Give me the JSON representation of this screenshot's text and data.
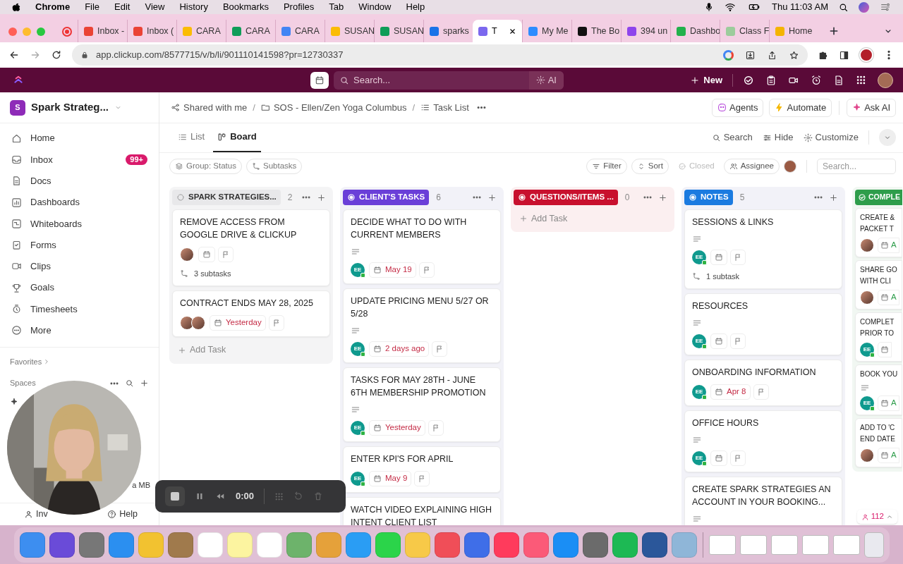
{
  "menu_bar": {
    "app": "Chrome",
    "items": [
      "File",
      "Edit",
      "View",
      "History",
      "Bookmarks",
      "Profiles",
      "Tab",
      "Window",
      "Help"
    ],
    "clock": "Thu 11:03 AM"
  },
  "browser": {
    "tabs": [
      {
        "title": "Inbox -",
        "color": "#ea4335",
        "selected": false
      },
      {
        "title": "Inbox (",
        "color": "#ea4335",
        "selected": false
      },
      {
        "title": "CARA",
        "color": "#fbbc04",
        "selected": false
      },
      {
        "title": "CARA",
        "color": "#0f9d58",
        "selected": false
      },
      {
        "title": "CARA",
        "color": "#4285f4",
        "selected": false
      },
      {
        "title": "SUSAN",
        "color": "#fbbc04",
        "selected": false
      },
      {
        "title": "SUSAN",
        "color": "#0f9d58",
        "selected": false
      },
      {
        "title": "sparks",
        "color": "#1a73e8",
        "selected": false
      },
      {
        "title": "T",
        "color": "#7b68ee",
        "selected": true
      },
      {
        "title": "My Me",
        "color": "#2d8cff",
        "selected": false
      },
      {
        "title": "The Bo",
        "color": "#111111",
        "selected": false
      },
      {
        "title": "394 un",
        "color": "#8e44ec",
        "selected": false
      },
      {
        "title": "Dashbo",
        "color": "#22b14c",
        "selected": false
      },
      {
        "title": "Class F",
        "color": "#9ccc9c",
        "selected": false
      },
      {
        "title": "Home",
        "color": "#f4b400",
        "selected": false
      }
    ],
    "url": "app.clickup.com/8577715/v/b/li/901110141598?pr=12730337"
  },
  "topbar": {
    "search_placeholder": "Search...",
    "ai": "AI",
    "new": "New"
  },
  "sidebar": {
    "workspace_initial": "S",
    "workspace": "Spark Strateg...",
    "items": [
      {
        "label": "Home"
      },
      {
        "label": "Inbox",
        "badge": "99+"
      },
      {
        "label": "Docs"
      },
      {
        "label": "Dashboards"
      },
      {
        "label": "Whiteboards"
      },
      {
        "label": "Forms"
      },
      {
        "label": "Clips"
      },
      {
        "label": "Goals"
      },
      {
        "label": "Timesheets"
      },
      {
        "label": "More"
      }
    ],
    "favorites": "Favorites",
    "spaces": "Spaces",
    "space_partial": "a MB",
    "invite": "Inv",
    "help": "Help"
  },
  "breadcrumb": [
    {
      "label": "Shared with me"
    },
    {
      "separator": "/",
      "label": "SOS - Ellen/Zen Yoga Columbus"
    },
    {
      "separator": "/",
      "label": "Task List"
    }
  ],
  "header_buttons": [
    "Agents",
    "Automate",
    "Ask AI"
  ],
  "views": [
    {
      "label": "List",
      "selected": false
    },
    {
      "label": "Board",
      "selected": true
    }
  ],
  "view_actions": [
    "Search",
    "Hide",
    "Customize"
  ],
  "chips": [
    "Group: Status",
    "Subtasks"
  ],
  "filters": [
    "Filter",
    "Sort",
    "Closed",
    "Assignee"
  ],
  "filter_search_placeholder": "Search...",
  "columns": [
    {
      "name": "SPARK STRATEGIES...",
      "count": "2",
      "kind": "todo",
      "color": "#e8e8ea",
      "add_task": "Add Task",
      "tasks": [
        {
          "title": "REMOVE ACCESS FROM GOOGLE DRIVE & CLICKUP",
          "description": false,
          "subtasks": "3 subtasks"
        },
        {
          "title": "CONTRACT ENDS MAY 28, 2025",
          "description": false,
          "date": "Yesterday",
          "overdue": true
        }
      ]
    },
    {
      "name": "CLIENT'S TASKS",
      "count": "6",
      "kind": "progress",
      "color": "#6a3fd8",
      "tasks": [
        {
          "title": "DECIDE WHAT TO DO WITH CURRENT MEMBERS",
          "description": true,
          "assignees": [
            {
              "kind": "initials",
              "initials": "EE"
            }
          ],
          "date": "May 19",
          "overdue": true
        },
        {
          "title": "UPDATE PRICING MENU 5/27 OR 5/28",
          "description": true,
          "assignees": [
            {
              "kind": "initials",
              "initials": "EE"
            }
          ],
          "date": "2 days ago",
          "overdue": true
        },
        {
          "title": "TASKS FOR MAY 28TH - JUNE 6TH MEMBERSHIP PROMOTION",
          "description": true,
          "assignees": [
            {
              "kind": "initials",
              "initials": "EE"
            }
          ],
          "date": "Yesterday",
          "overdue": true
        },
        {
          "title": "ENTER KPI'S FOR APRIL",
          "description": false,
          "assignees": [
            {
              "kind": "initials",
              "initials": "EE"
            }
          ],
          "date": "May 9",
          "overdue": true
        },
        {
          "title": "WATCH VIDEO EXPLAINING HIGH INTENT CLIENT LIST",
          "description": false
        }
      ]
    },
    {
      "name": "QUESTIONS/ITEMS ...",
      "count": "0",
      "kind": "progress",
      "color": "#c8102e",
      "add_task": "Add Task"
    },
    {
      "name": "NOTES",
      "count": "5",
      "kind": "progress",
      "color": "#1b7be0",
      "tasks": [
        {
          "title": "SESSIONS & LINKS",
          "description": true,
          "assignees": [
            {
              "kind": "initials",
              "initials": "EE"
            }
          ],
          "subtasks": "1 subtask"
        },
        {
          "title": "RESOURCES",
          "description": true,
          "assignees": [
            {
              "kind": "initials",
              "initials": "EE"
            }
          ]
        },
        {
          "title": "ONBOARDING INFORMATION",
          "description": false,
          "assignees": [
            {
              "kind": "initials",
              "initials": "EE"
            }
          ],
          "date": "Apr 8",
          "overdue": true
        },
        {
          "title": "OFFICE HOURS",
          "description": true,
          "assignees": [
            {
              "kind": "initials",
              "initials": "EE"
            }
          ]
        },
        {
          "title": "CREATE SPARK STRATEGIES AN ACCOUNT IN YOUR BOOKING...",
          "description": true
        }
      ]
    },
    {
      "name": "COMPLE",
      "kind": "done",
      "color": "#2e9d4b",
      "partial": true,
      "tasks": [
        {
          "title": "CREATE &\nPACKET T",
          "description": false,
          "date": "A",
          "overdue": false
        },
        {
          "title": "SHARE GO\nWITH CLI",
          "description": false,
          "date": "A",
          "overdue": false
        },
        {
          "title": "COMPLET\nPRIOR TO",
          "description": false,
          "assignees": [
            {
              "kind": "initials",
              "initials": "EE"
            }
          ]
        },
        {
          "title": "BOOK YOU",
          "description": true,
          "assignees": [
            {
              "kind": "initials",
              "initials": "EE"
            }
          ],
          "date": "A",
          "overdue": false
        },
        {
          "title": "ADD TO 'C\nEND DATE",
          "description": false,
          "date": "A",
          "overdue": false
        }
      ]
    }
  ],
  "people_count": "112",
  "recorder": {
    "time": "0:00"
  }
}
